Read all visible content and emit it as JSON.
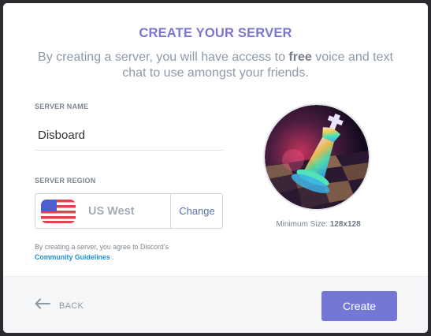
{
  "dialog": {
    "title": "CREATE YOUR SERVER",
    "subtitle_prefix": "By creating a server, you will have access to ",
    "subtitle_bold": "free",
    "subtitle_suffix": " voice and text chat to use amongst your friends."
  },
  "server_name": {
    "label": "SERVER NAME",
    "value": "Disboard"
  },
  "server_region": {
    "label": "SERVER REGION",
    "flag_icon": "us-flag-icon",
    "value": "US West",
    "change_label": "Change"
  },
  "terms": {
    "prefix": "By creating a server, you agree to Discord's",
    "link": "Community Guidelines",
    "suffix": " ."
  },
  "icon_upload": {
    "image": "chess-king-glowing-image",
    "min_size_label": "Minimum Size: ",
    "min_size_value": "128x128"
  },
  "footer": {
    "back_icon": "arrow-left-icon",
    "back_label": "BACK",
    "create_label": "Create"
  },
  "colors": {
    "accent": "#7477d6",
    "title": "#7b75cf",
    "link": "#1e8fd3",
    "backdrop": "#2b2c30"
  }
}
